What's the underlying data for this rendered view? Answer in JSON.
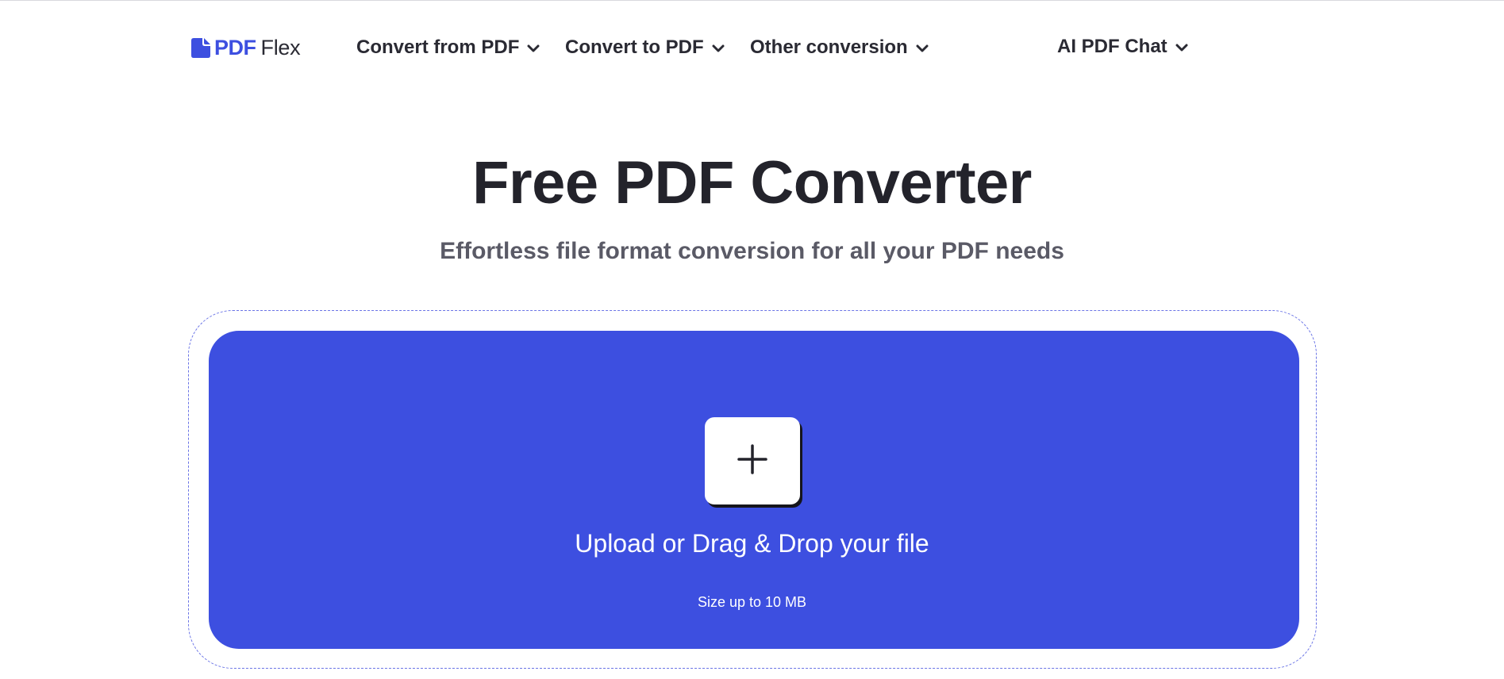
{
  "header": {
    "logo": {
      "brand": "PDF",
      "suffix": "Flex",
      "icon": "document-icon"
    },
    "nav": [
      {
        "label": "Convert from PDF",
        "icon": "chevron-down-icon"
      },
      {
        "label": "Convert to PDF",
        "icon": "chevron-down-icon"
      },
      {
        "label": "Other conversion",
        "icon": "chevron-down-icon"
      },
      {
        "label": "AI PDF Chat",
        "icon": "chevron-down-icon"
      }
    ]
  },
  "hero": {
    "title": "Free PDF Converter",
    "subtitle": "Effortless file format conversion for all your PDF needs"
  },
  "upload": {
    "button_icon": "plus-icon",
    "label": "Upload or Drag & Drop your file",
    "size_note": "Size up to 10 MB"
  },
  "colors": {
    "accent": "#3d4fe0",
    "text_dark": "#23232b",
    "text_muted": "#5a5a66",
    "background": "#ffffff"
  }
}
